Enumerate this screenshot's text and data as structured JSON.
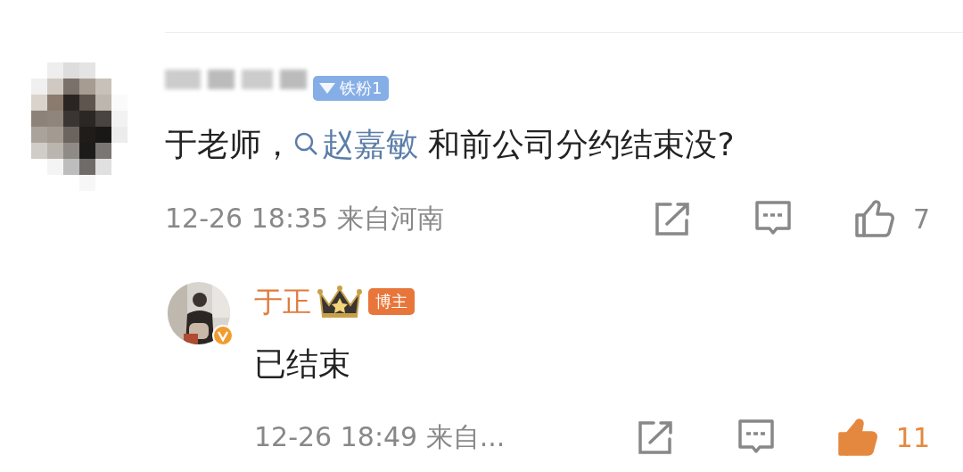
{
  "comments": [
    {
      "kind": "comment",
      "badge": {
        "kind": "fan",
        "label": "铁粉1"
      },
      "text": [
        {
          "kind": "plain",
          "text": "于老师，"
        },
        {
          "kind": "topic",
          "text": "赵嘉敏"
        },
        {
          "kind": "plain",
          "text": " 和前公司分约结束没?"
        }
      ],
      "time": "12-26 18:35",
      "location": "来自河南",
      "liked": false,
      "like_count": "7",
      "replies": [
        {
          "kind": "reply",
          "name": "于正",
          "verified": true,
          "badge": {
            "kind": "author",
            "label": "博主"
          },
          "text": [
            {
              "kind": "plain",
              "text": "已结束"
            }
          ],
          "time": "12-26 18:49",
          "location": "来自...",
          "liked": true,
          "like_count": "11"
        }
      ]
    }
  ]
}
